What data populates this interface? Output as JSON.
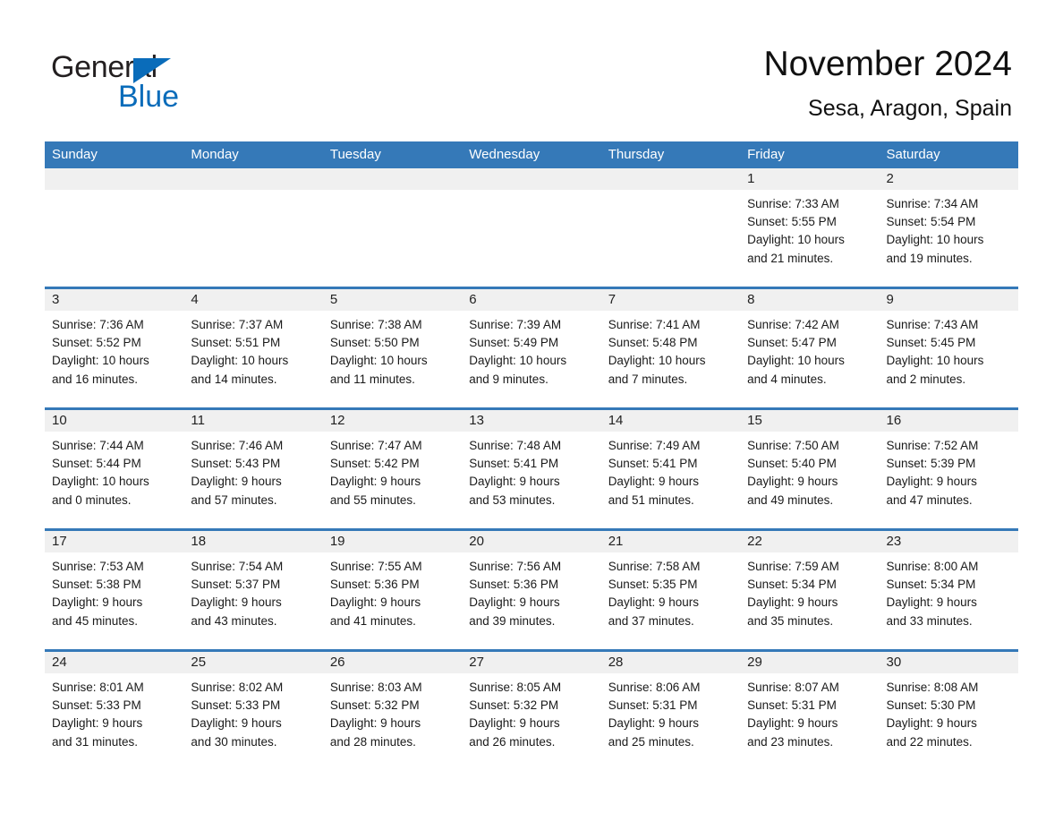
{
  "brand": {
    "name_part1": "General",
    "name_part2": "Blue",
    "triangle_color": "#0a6cba",
    "blue_color": "#0a6cba"
  },
  "header": {
    "title": "November 2024",
    "subtitle": "Sesa, Aragon, Spain"
  },
  "theme": {
    "header_blue": "#3579b8",
    "daynum_band": "#f0f0f0",
    "text": "#1a1a1a"
  },
  "weekdays": [
    "Sunday",
    "Monday",
    "Tuesday",
    "Wednesday",
    "Thursday",
    "Friday",
    "Saturday"
  ],
  "weeks": [
    [
      {
        "day": "",
        "sunrise": "",
        "sunset": "",
        "daylight_1": "",
        "daylight_2": ""
      },
      {
        "day": "",
        "sunrise": "",
        "sunset": "",
        "daylight_1": "",
        "daylight_2": ""
      },
      {
        "day": "",
        "sunrise": "",
        "sunset": "",
        "daylight_1": "",
        "daylight_2": ""
      },
      {
        "day": "",
        "sunrise": "",
        "sunset": "",
        "daylight_1": "",
        "daylight_2": ""
      },
      {
        "day": "",
        "sunrise": "",
        "sunset": "",
        "daylight_1": "",
        "daylight_2": ""
      },
      {
        "day": "1",
        "sunrise": "Sunrise: 7:33 AM",
        "sunset": "Sunset: 5:55 PM",
        "daylight_1": "Daylight: 10 hours",
        "daylight_2": "and 21 minutes."
      },
      {
        "day": "2",
        "sunrise": "Sunrise: 7:34 AM",
        "sunset": "Sunset: 5:54 PM",
        "daylight_1": "Daylight: 10 hours",
        "daylight_2": "and 19 minutes."
      }
    ],
    [
      {
        "day": "3",
        "sunrise": "Sunrise: 7:36 AM",
        "sunset": "Sunset: 5:52 PM",
        "daylight_1": "Daylight: 10 hours",
        "daylight_2": "and 16 minutes."
      },
      {
        "day": "4",
        "sunrise": "Sunrise: 7:37 AM",
        "sunset": "Sunset: 5:51 PM",
        "daylight_1": "Daylight: 10 hours",
        "daylight_2": "and 14 minutes."
      },
      {
        "day": "5",
        "sunrise": "Sunrise: 7:38 AM",
        "sunset": "Sunset: 5:50 PM",
        "daylight_1": "Daylight: 10 hours",
        "daylight_2": "and 11 minutes."
      },
      {
        "day": "6",
        "sunrise": "Sunrise: 7:39 AM",
        "sunset": "Sunset: 5:49 PM",
        "daylight_1": "Daylight: 10 hours",
        "daylight_2": "and 9 minutes."
      },
      {
        "day": "7",
        "sunrise": "Sunrise: 7:41 AM",
        "sunset": "Sunset: 5:48 PM",
        "daylight_1": "Daylight: 10 hours",
        "daylight_2": "and 7 minutes."
      },
      {
        "day": "8",
        "sunrise": "Sunrise: 7:42 AM",
        "sunset": "Sunset: 5:47 PM",
        "daylight_1": "Daylight: 10 hours",
        "daylight_2": "and 4 minutes."
      },
      {
        "day": "9",
        "sunrise": "Sunrise: 7:43 AM",
        "sunset": "Sunset: 5:45 PM",
        "daylight_1": "Daylight: 10 hours",
        "daylight_2": "and 2 minutes."
      }
    ],
    [
      {
        "day": "10",
        "sunrise": "Sunrise: 7:44 AM",
        "sunset": "Sunset: 5:44 PM",
        "daylight_1": "Daylight: 10 hours",
        "daylight_2": "and 0 minutes."
      },
      {
        "day": "11",
        "sunrise": "Sunrise: 7:46 AM",
        "sunset": "Sunset: 5:43 PM",
        "daylight_1": "Daylight: 9 hours",
        "daylight_2": "and 57 minutes."
      },
      {
        "day": "12",
        "sunrise": "Sunrise: 7:47 AM",
        "sunset": "Sunset: 5:42 PM",
        "daylight_1": "Daylight: 9 hours",
        "daylight_2": "and 55 minutes."
      },
      {
        "day": "13",
        "sunrise": "Sunrise: 7:48 AM",
        "sunset": "Sunset: 5:41 PM",
        "daylight_1": "Daylight: 9 hours",
        "daylight_2": "and 53 minutes."
      },
      {
        "day": "14",
        "sunrise": "Sunrise: 7:49 AM",
        "sunset": "Sunset: 5:41 PM",
        "daylight_1": "Daylight: 9 hours",
        "daylight_2": "and 51 minutes."
      },
      {
        "day": "15",
        "sunrise": "Sunrise: 7:50 AM",
        "sunset": "Sunset: 5:40 PM",
        "daylight_1": "Daylight: 9 hours",
        "daylight_2": "and 49 minutes."
      },
      {
        "day": "16",
        "sunrise": "Sunrise: 7:52 AM",
        "sunset": "Sunset: 5:39 PM",
        "daylight_1": "Daylight: 9 hours",
        "daylight_2": "and 47 minutes."
      }
    ],
    [
      {
        "day": "17",
        "sunrise": "Sunrise: 7:53 AM",
        "sunset": "Sunset: 5:38 PM",
        "daylight_1": "Daylight: 9 hours",
        "daylight_2": "and 45 minutes."
      },
      {
        "day": "18",
        "sunrise": "Sunrise: 7:54 AM",
        "sunset": "Sunset: 5:37 PM",
        "daylight_1": "Daylight: 9 hours",
        "daylight_2": "and 43 minutes."
      },
      {
        "day": "19",
        "sunrise": "Sunrise: 7:55 AM",
        "sunset": "Sunset: 5:36 PM",
        "daylight_1": "Daylight: 9 hours",
        "daylight_2": "and 41 minutes."
      },
      {
        "day": "20",
        "sunrise": "Sunrise: 7:56 AM",
        "sunset": "Sunset: 5:36 PM",
        "daylight_1": "Daylight: 9 hours",
        "daylight_2": "and 39 minutes."
      },
      {
        "day": "21",
        "sunrise": "Sunrise: 7:58 AM",
        "sunset": "Sunset: 5:35 PM",
        "daylight_1": "Daylight: 9 hours",
        "daylight_2": "and 37 minutes."
      },
      {
        "day": "22",
        "sunrise": "Sunrise: 7:59 AM",
        "sunset": "Sunset: 5:34 PM",
        "daylight_1": "Daylight: 9 hours",
        "daylight_2": "and 35 minutes."
      },
      {
        "day": "23",
        "sunrise": "Sunrise: 8:00 AM",
        "sunset": "Sunset: 5:34 PM",
        "daylight_1": "Daylight: 9 hours",
        "daylight_2": "and 33 minutes."
      }
    ],
    [
      {
        "day": "24",
        "sunrise": "Sunrise: 8:01 AM",
        "sunset": "Sunset: 5:33 PM",
        "daylight_1": "Daylight: 9 hours",
        "daylight_2": "and 31 minutes."
      },
      {
        "day": "25",
        "sunrise": "Sunrise: 8:02 AM",
        "sunset": "Sunset: 5:33 PM",
        "daylight_1": "Daylight: 9 hours",
        "daylight_2": "and 30 minutes."
      },
      {
        "day": "26",
        "sunrise": "Sunrise: 8:03 AM",
        "sunset": "Sunset: 5:32 PM",
        "daylight_1": "Daylight: 9 hours",
        "daylight_2": "and 28 minutes."
      },
      {
        "day": "27",
        "sunrise": "Sunrise: 8:05 AM",
        "sunset": "Sunset: 5:32 PM",
        "daylight_1": "Daylight: 9 hours",
        "daylight_2": "and 26 minutes."
      },
      {
        "day": "28",
        "sunrise": "Sunrise: 8:06 AM",
        "sunset": "Sunset: 5:31 PM",
        "daylight_1": "Daylight: 9 hours",
        "daylight_2": "and 25 minutes."
      },
      {
        "day": "29",
        "sunrise": "Sunrise: 8:07 AM",
        "sunset": "Sunset: 5:31 PM",
        "daylight_1": "Daylight: 9 hours",
        "daylight_2": "and 23 minutes."
      },
      {
        "day": "30",
        "sunrise": "Sunrise: 8:08 AM",
        "sunset": "Sunset: 5:30 PM",
        "daylight_1": "Daylight: 9 hours",
        "daylight_2": "and 22 minutes."
      }
    ]
  ]
}
